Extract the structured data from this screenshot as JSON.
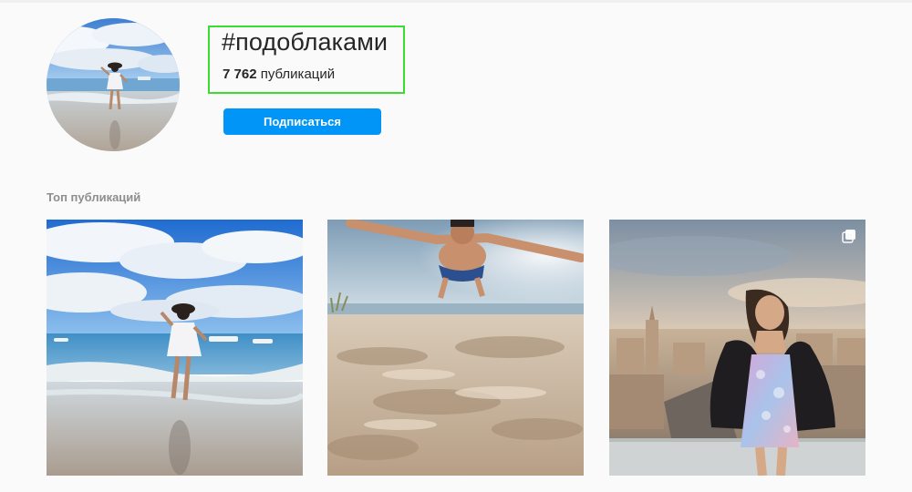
{
  "header": {
    "hashtag": "#подоблаками",
    "post_count": "7 762",
    "post_label": "публикаций",
    "follow_label": "Подписаться"
  },
  "top_posts": {
    "title": "Топ публикаций",
    "items": [
      {
        "icon": "photo",
        "description": "woman-on-beach"
      },
      {
        "icon": "photo",
        "description": "man-jumping-over-sand"
      },
      {
        "icon": "carousel-icon",
        "description": "woman-on-rooftop"
      }
    ]
  },
  "colors": {
    "accent": "#0095f6",
    "highlight_border": "#3ddc33",
    "background": "#fafafa",
    "muted_text": "#8e8e8e"
  }
}
